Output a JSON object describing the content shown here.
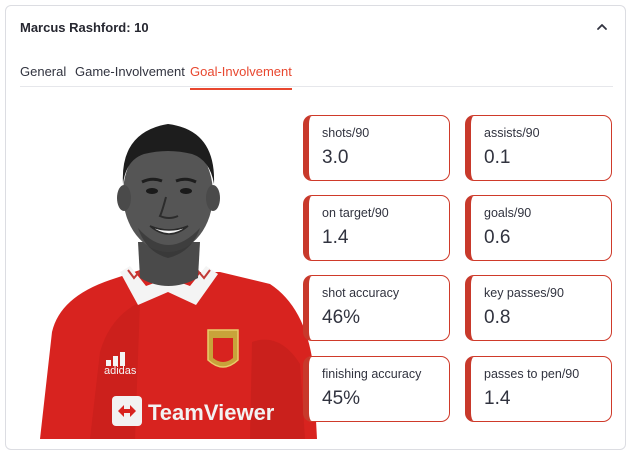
{
  "expander": {
    "title": "Marcus Rashford: 10"
  },
  "tabs": [
    {
      "label": "General"
    },
    {
      "label": "Game-Involvement"
    },
    {
      "label": "Goal-Involvement"
    }
  ],
  "active_tab": "Goal-Involvement",
  "player": {
    "shirt_sponsor": "TeamViewer",
    "kit_brand": "adidas"
  },
  "stats": [
    {
      "label": "shots/90",
      "value": "3.0"
    },
    {
      "label": "assists/90",
      "value": "0.1"
    },
    {
      "label": "on target/90",
      "value": "1.4"
    },
    {
      "label": "goals/90",
      "value": "0.6"
    },
    {
      "label": "shot accuracy",
      "value": "46%"
    },
    {
      "label": "key passes/90",
      "value": "0.8"
    },
    {
      "label": "finishing accuracy",
      "value": "45%"
    },
    {
      "label": "passes to pen/90",
      "value": "1.4"
    }
  ],
  "colors": {
    "accent": "#e8472f",
    "card_border": "#c8392b",
    "shirt": "#d8231f"
  }
}
